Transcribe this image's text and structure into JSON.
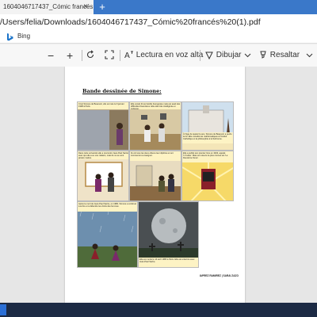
{
  "browser": {
    "tab_title": "1604046717437_Cómic francés (1).pdf",
    "tab_close": "×",
    "new_tab": "+",
    "address": "/Users/felia/Downloads/1604046717437_C%C3%B3mic%20franc%C3%A9s%20(1).pdf",
    "address_display": "/Users/felia/Downloads/1604046717437_Cómic%20francés%20(1).pdf",
    "favorites": [
      {
        "label": "Bing",
        "icon": "bing-icon"
      }
    ]
  },
  "pdf_toolbar": {
    "zoom_out": "−",
    "zoom_in": "+",
    "read_aloud": "Lectura en voz alta",
    "draw": "Dibujar",
    "highlight": "Resaltar"
  },
  "document": {
    "title": "Bande dessinée de Simone:",
    "author": "IAPREZ RAMIREZ | SARAI ZAZO",
    "captions": [
      "C'est Simone de Beauvoir, elle est née le 9 janvier 1908 à Paris.",
      "Elle venait d'une famille bourgeoise mais qui avait des difficultés financières. Elle était très intelligente et curieuse.",
      "À l'âge de quatorze ans, Simone de Beauvoir a perdu la foi. Elle a étudié les mathématiques à l'Institut Catholique et la philosophie à la Sorbonne.",
      "Dans cette université elle a rencontré Jean-Paul Sartre, avec qui elle a eu une relation, mais ils ne se sont jamais mariés.",
      "Ils ont tous les deux obtenu leur diplôme et ont commencé à enseigner.",
      "Elle a publié son premier livre en 1943, appelé 'L'Invitée'. Mais son œuvre la plus connue est 'Le Deuxième Sexe'.",
      "Après la mort de Jean-Paul Sartre, en 1980, Simone a continué à écrire et à défendre les droits des femmes.",
      "Elle est morte le 14 avril 1986 à Paris. Elle est enterrée avec Jean-Paul Sartre."
    ]
  }
}
